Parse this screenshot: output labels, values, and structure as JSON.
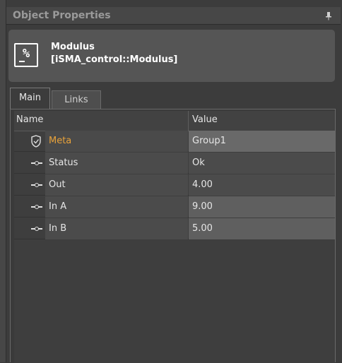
{
  "panel": {
    "title": "Object Properties",
    "pin_icon": "pin-icon"
  },
  "object": {
    "icon": "modulus-icon",
    "icon_glyph": "%",
    "name": "Modulus",
    "type": "[iSMA_control::Modulus]"
  },
  "tabs": [
    {
      "label": "Main",
      "active": true
    },
    {
      "label": "Links",
      "active": false
    }
  ],
  "table": {
    "columns": [
      "Name",
      "Value"
    ],
    "rows": [
      {
        "icon": "shield-icon",
        "name": "Meta",
        "value": "Group1"
      },
      {
        "icon": "slot-icon",
        "name": "Status",
        "value": "Ok"
      },
      {
        "icon": "slot-icon",
        "name": "Out",
        "value": "4.00"
      },
      {
        "icon": "slot-icon",
        "name": "In A",
        "value": "9.00"
      },
      {
        "icon": "slot-icon",
        "name": "In B",
        "value": "5.00"
      }
    ]
  },
  "colors": {
    "meta_label": "#e8a23a",
    "background": "#3c3c3c"
  }
}
